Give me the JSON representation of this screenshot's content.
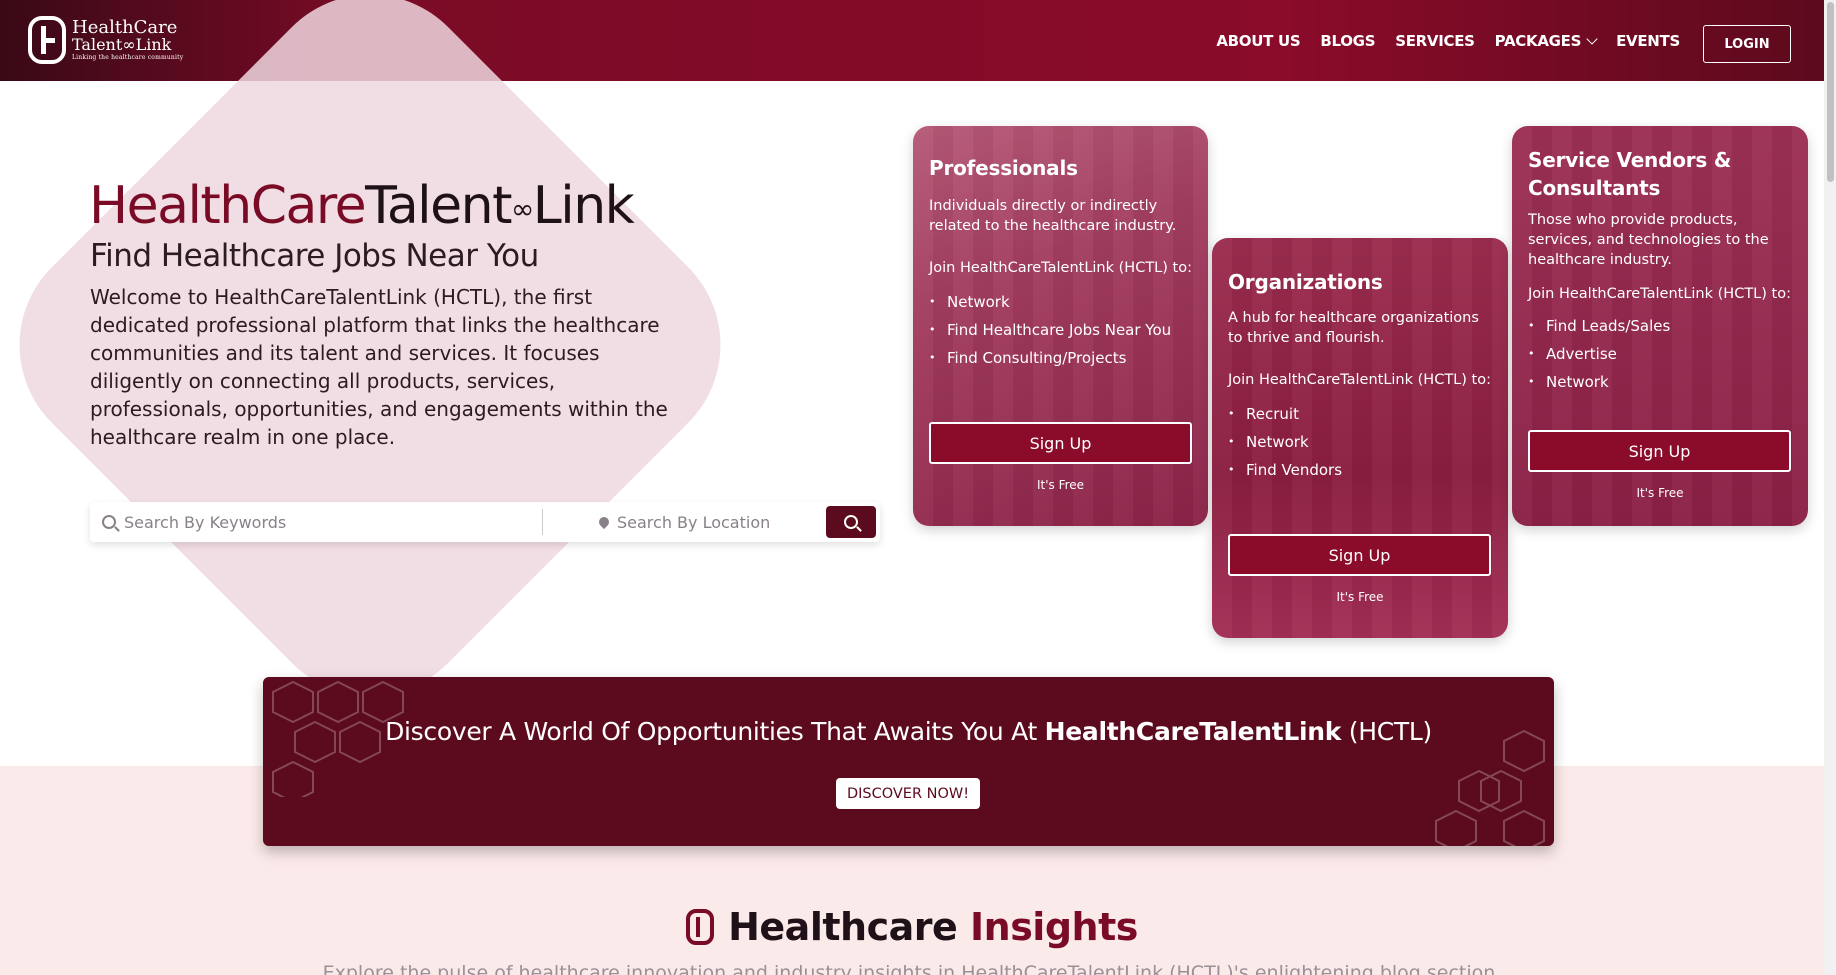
{
  "header": {
    "logo": {
      "line1": "HealthCare",
      "line2": "Talent∞Link",
      "tagline": "Linking the healthcare community"
    },
    "nav": [
      "ABOUT US",
      "BLOGS",
      "SERVICES",
      "PACKAGES",
      "EVENTS"
    ],
    "login": "LOGIN"
  },
  "hero": {
    "title_red": "HealthCare",
    "title_dark": "Talent",
    "title_link": "∞",
    "title_end": "Link",
    "subtitle": "Find Healthcare Jobs Near You",
    "description": "Welcome to HealthCareTalentLink (HCTL), the first dedicated professional platform that links the healthcare communities and its talent and services. It focuses diligently on connecting all products, services, professionals, opportunities, and engagements within the healthcare realm in one place."
  },
  "search": {
    "keyword_placeholder": "Search By Keywords",
    "location_placeholder": "Search By Location"
  },
  "cards": {
    "professionals": {
      "title": "Professionals",
      "desc": "Individuals directly or indirectly related to the healthcare industry.",
      "join": "Join HealthCareTalentLink (HCTL) to:",
      "items": [
        "Network",
        "Find Healthcare Jobs Near You",
        "Find Consulting/Projects"
      ],
      "signup": "Sign Up",
      "free": "It's Free"
    },
    "organizations": {
      "title": "Organizations",
      "desc": "A hub for healthcare organizations to thrive and flourish.",
      "join": "Join HealthCareTalentLink (HCTL) to:",
      "items": [
        "Recruit",
        "Network",
        "Find Vendors"
      ],
      "signup": "Sign Up",
      "free": "It's Free"
    },
    "vendors": {
      "title": "Service Vendors & Consultants",
      "desc": "Those who provide products, services, and technologies to the healthcare industry.",
      "join": "Join HealthCareTalentLink (HCTL) to:",
      "items": [
        "Find Leads/Sales",
        "Advertise",
        "Network"
      ],
      "signup": "Sign Up",
      "free": "It's Free"
    }
  },
  "banner": {
    "text_pre": "Discover A World Of Opportunities That Awaits You At ",
    "text_bold": "HealthCareTalentLink",
    "text_post": " (HCTL)",
    "button": "DISCOVER NOW!"
  },
  "insights": {
    "title_dark": "Healthcare",
    "title_red": "Insights",
    "desc": "Explore the pulse of healthcare innovation and industry insights in HealthCareTalentLink (HCTL)'s enlightening blog section."
  },
  "colors": {
    "brand": "#8a0b2a",
    "brand_dark": "#5c0a1d",
    "accent_bg": "#fbeaea"
  }
}
